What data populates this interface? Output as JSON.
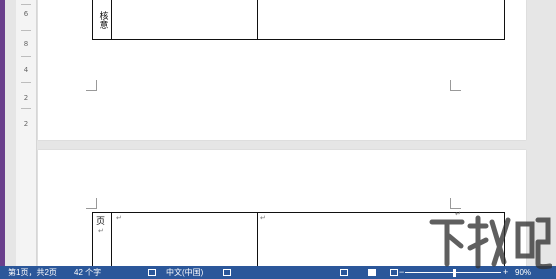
{
  "ruler": {
    "numbers": [
      "6",
      "8",
      "4",
      "2",
      "2"
    ]
  },
  "page1": {
    "table_label": "核意"
  },
  "page2": {
    "table_label": "页",
    "para_mark": "↵"
  },
  "statusbar": {
    "page_info": "第1页，共2页",
    "word_count": "42 个字",
    "language": "中文(中国)",
    "zoom_minus": "−",
    "zoom_plus": "+",
    "zoom_level": "90%"
  },
  "watermark": {
    "text": "下载吧"
  }
}
